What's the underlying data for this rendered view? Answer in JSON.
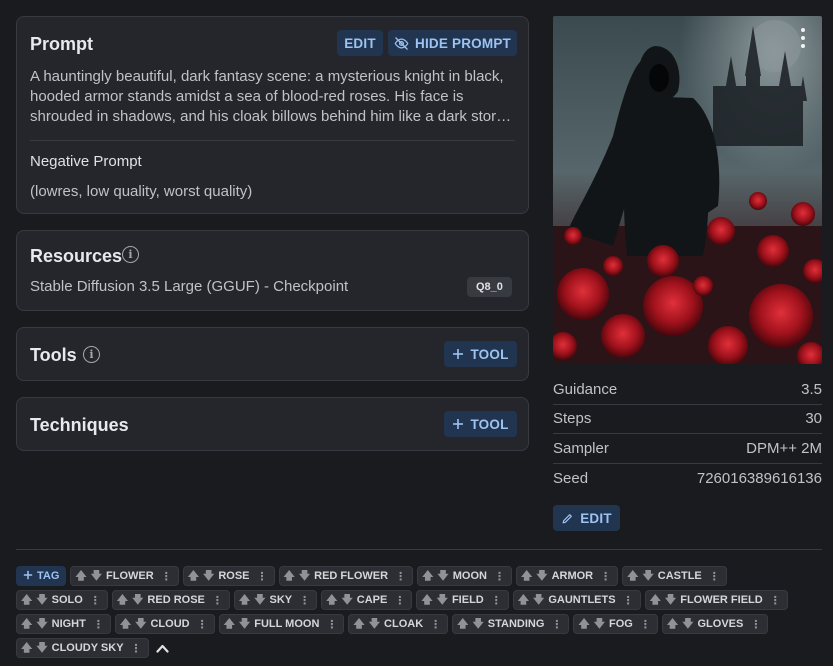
{
  "prompt_card": {
    "title": "Prompt",
    "edit_label": "EDIT",
    "hide_label": "HIDE PROMPT",
    "text": "A hauntingly beautiful, dark fantasy scene: a mysterious knight in black, hooded armor stands amidst a sea of blood-red roses. His face is shrouded in shadows, and his cloak billows behind him like a dark storm cloud.",
    "negative_title": "Negative Prompt",
    "negative_text": "(lowres, low quality, worst quality)"
  },
  "resources_card": {
    "title": "Resources",
    "resource_name": "Stable Diffusion 3.5 Large (GGUF) - Checkpoint",
    "resource_badge": "Q8_0"
  },
  "tools_card": {
    "title": "Tools",
    "add_label": "TOOL"
  },
  "techniques_card": {
    "title": "Techniques",
    "add_label": "TOOL"
  },
  "generation": {
    "rows": [
      {
        "label": "Guidance",
        "value": "3.5"
      },
      {
        "label": "Steps",
        "value": "30"
      },
      {
        "label": "Sampler",
        "value": "DPM++ 2M"
      },
      {
        "label": "Seed",
        "value": "726016389616136"
      }
    ],
    "edit_label": "EDIT"
  },
  "tags": {
    "add_label": "TAG",
    "items": [
      "FLOWER",
      "ROSE",
      "RED FLOWER",
      "MOON",
      "ARMOR",
      "CASTLE",
      "SOLO",
      "RED ROSE",
      "SKY",
      "CAPE",
      "FIELD",
      "GAUNTLETS",
      "FLOWER FIELD",
      "NIGHT",
      "CLOUD",
      "FULL MOON",
      "CLOAK",
      "STANDING",
      "FOG",
      "GLOVES",
      "CLOUDY SKY"
    ]
  },
  "colors": {
    "background": "#1a1b1e",
    "card": "#25262b",
    "accent_button": "#213550",
    "accent_text": "#9cc3f2"
  }
}
